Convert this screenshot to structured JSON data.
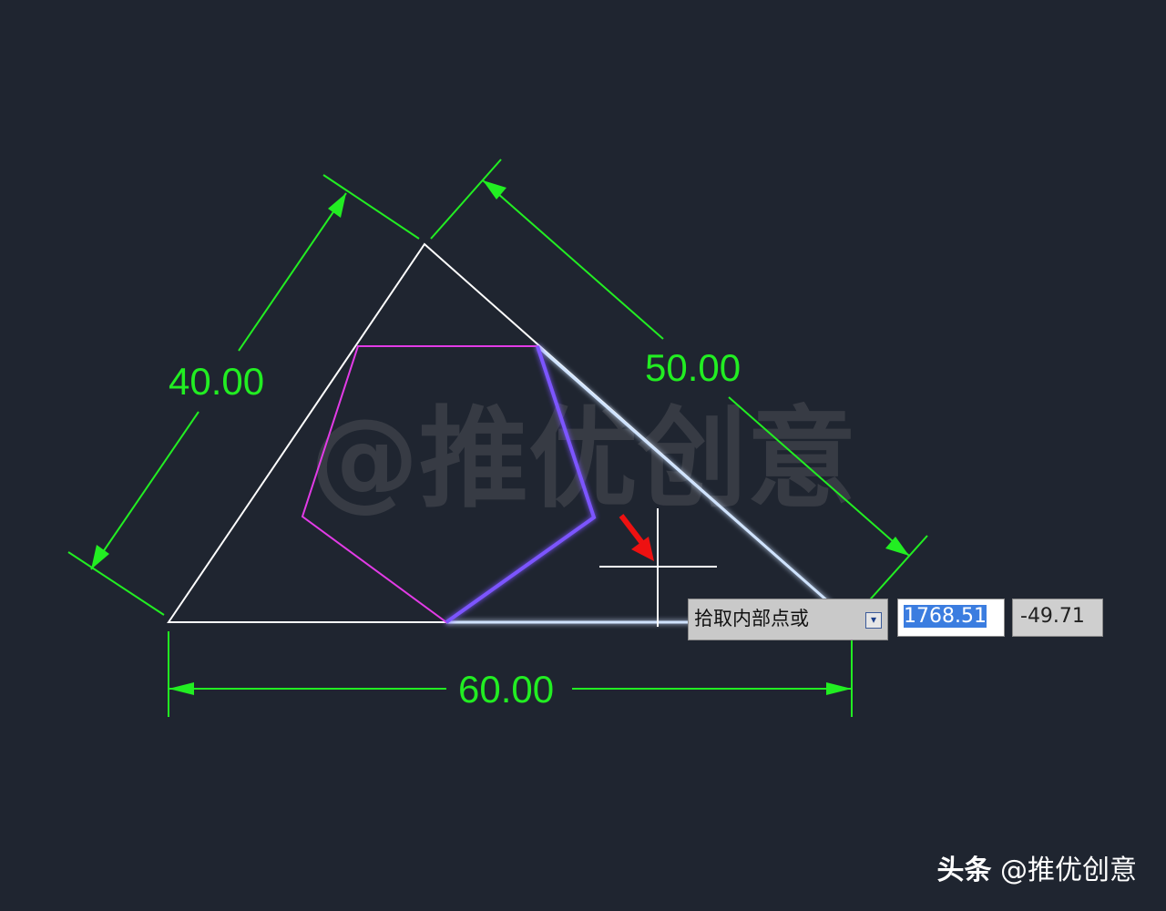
{
  "dimensions": {
    "left_side": "40.00",
    "right_side": "50.00",
    "bottom": "60.00"
  },
  "watermark": "@推优创意",
  "command": {
    "prompt": "拾取内部点或",
    "dropdown_icon": "dropdown-arrow-icon",
    "x_value": "1768.51",
    "y_value": "-49.71"
  },
  "credit": {
    "brand": "头条",
    "handle": "@推优创意"
  },
  "colors": {
    "background": "#1f2530",
    "dimension": "#22ee22",
    "triangle": "#ffffff",
    "polygon": "#e23be6",
    "highlight": "#7b55ff",
    "selection": "#cfe3ff",
    "cursor_arrow": "#ee1111"
  }
}
